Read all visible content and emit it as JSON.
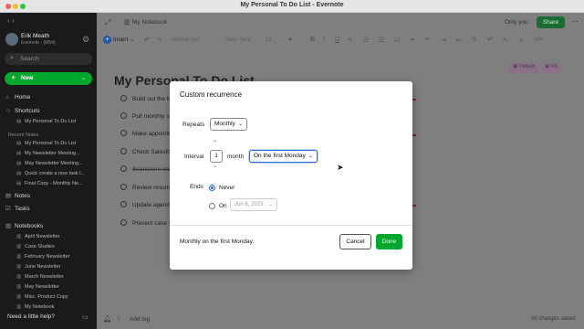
{
  "window": {
    "title": "My Personal To Do List - Evernote"
  },
  "sidebar": {
    "user_name": "Erik Meath",
    "user_sub": "Evernote - (M54)",
    "search_placeholder": "Search",
    "new_label": "New",
    "home": "Home",
    "shortcuts": "Shortcuts",
    "shortcut_items": [
      "My Personal To Do List"
    ],
    "recent_caption": "Recent Notes",
    "recent_items": [
      "My Personal To Do List",
      "My Newsletter Meeting...",
      "May Newsletter Meeting...",
      "Quick create a new task l...",
      "Final Copy - Monthly Ne..."
    ],
    "notes": "Notes",
    "tasks": "Tasks",
    "notebooks": "Notebooks",
    "notebook_items": [
      "April Newsletter",
      "Case Studies",
      "February Newsletter",
      "June Newsletter",
      "March Newsletter",
      "May Newsletter",
      "Misc. Product Copy",
      "My Notebook"
    ],
    "help": "Need a little help?"
  },
  "topbar": {
    "notebook": "My Notebook",
    "only_you": "Only you",
    "share": "Share"
  },
  "toolbar": {
    "insert": "Insert",
    "style": "Normal text",
    "font": "Sans Serif",
    "size": "15"
  },
  "tags": {
    "default": "Default",
    "us": "US"
  },
  "note": {
    "title": "My Personal To Do List",
    "todos": [
      {
        "text": "Build out the b",
        "done": false
      },
      {
        "text": "Pull monthly s",
        "done": false
      },
      {
        "text": "Make appointn",
        "done": false
      },
      {
        "text": "Check Salesfor",
        "done": false
      },
      {
        "text": "Brainstorm ide",
        "done": true
      },
      {
        "text": "Review resume",
        "done": false
      },
      {
        "text": "Update agenda",
        "done": false
      },
      {
        "text": "Present case st",
        "done": false
      }
    ]
  },
  "bottom": {
    "add_tag": "Add tag",
    "saved": "All changes saved"
  },
  "dialog": {
    "title": "Custom recurrence",
    "repeats_label": "Repeats",
    "repeats_value": "Monthly",
    "interval_label": "Interval",
    "interval_value": "1",
    "interval_unit": "month",
    "interval_option": "On the first Monday",
    "ends_label": "Ends",
    "never_label": "Never",
    "on_label": "On",
    "on_date": "Jun 6, 2023",
    "summary": "Monthly on the first Monday.",
    "cancel": "Cancel",
    "done": "Done"
  },
  "colors": {
    "accent": "#00a82d",
    "focus": "#2b6fd6"
  }
}
